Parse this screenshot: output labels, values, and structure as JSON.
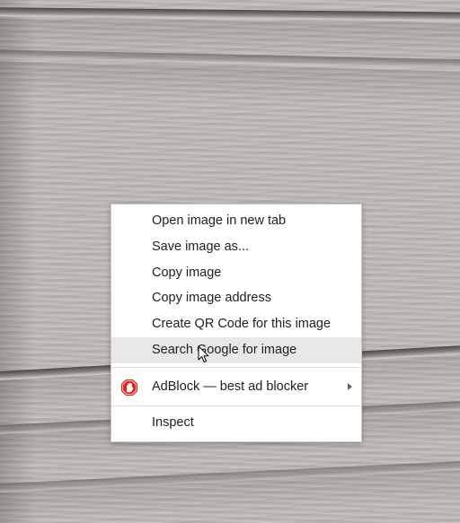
{
  "background": {
    "description_icon": "wood-grain-siding-photo"
  },
  "context_menu": {
    "items": [
      {
        "label": "Open image in new tab"
      },
      {
        "label": "Save image as..."
      },
      {
        "label": "Copy image"
      },
      {
        "label": "Copy image address"
      },
      {
        "label": "Create QR Code for this image"
      },
      {
        "label": "Search Google for image",
        "highlighted": true
      }
    ],
    "extension_item": {
      "label": "AdBlock — best ad blocker",
      "icon": "adblock-hand-icon",
      "icon_color": "#e8221b",
      "has_submenu": true
    },
    "inspect_item": {
      "label": "Inspect"
    }
  },
  "cursor": {
    "icon": "mouse-pointer-icon"
  },
  "colors": {
    "menu_background": "#ffffff",
    "highlight": "#e8e8e9",
    "text": "#202124"
  }
}
